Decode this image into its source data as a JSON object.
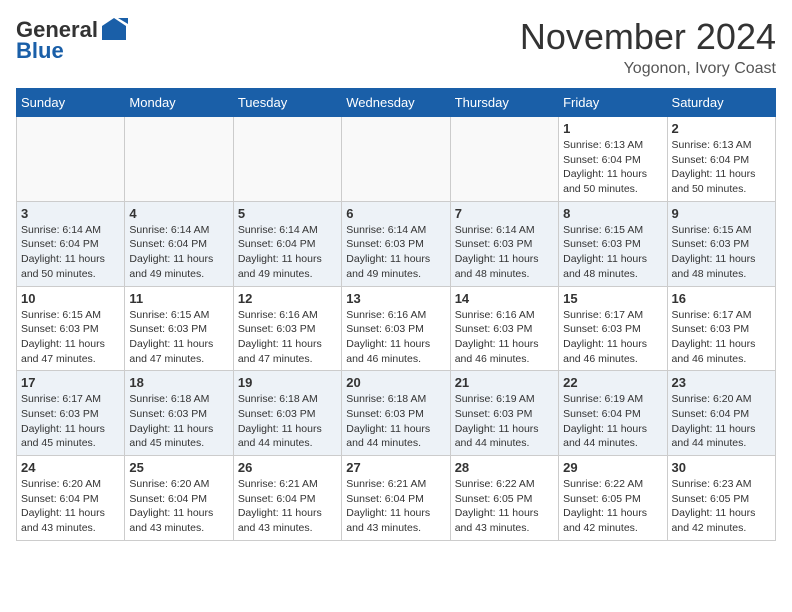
{
  "header": {
    "logo_general": "General",
    "logo_blue": "Blue",
    "month_title": "November 2024",
    "location": "Yogonon, Ivory Coast"
  },
  "weekdays": [
    "Sunday",
    "Monday",
    "Tuesday",
    "Wednesday",
    "Thursday",
    "Friday",
    "Saturday"
  ],
  "weeks": [
    [
      {
        "day": "",
        "info": ""
      },
      {
        "day": "",
        "info": ""
      },
      {
        "day": "",
        "info": ""
      },
      {
        "day": "",
        "info": ""
      },
      {
        "day": "",
        "info": ""
      },
      {
        "day": "1",
        "info": "Sunrise: 6:13 AM\nSunset: 6:04 PM\nDaylight: 11 hours and 50 minutes."
      },
      {
        "day": "2",
        "info": "Sunrise: 6:13 AM\nSunset: 6:04 PM\nDaylight: 11 hours and 50 minutes."
      }
    ],
    [
      {
        "day": "3",
        "info": "Sunrise: 6:14 AM\nSunset: 6:04 PM\nDaylight: 11 hours and 50 minutes."
      },
      {
        "day": "4",
        "info": "Sunrise: 6:14 AM\nSunset: 6:04 PM\nDaylight: 11 hours and 49 minutes."
      },
      {
        "day": "5",
        "info": "Sunrise: 6:14 AM\nSunset: 6:04 PM\nDaylight: 11 hours and 49 minutes."
      },
      {
        "day": "6",
        "info": "Sunrise: 6:14 AM\nSunset: 6:03 PM\nDaylight: 11 hours and 49 minutes."
      },
      {
        "day": "7",
        "info": "Sunrise: 6:14 AM\nSunset: 6:03 PM\nDaylight: 11 hours and 48 minutes."
      },
      {
        "day": "8",
        "info": "Sunrise: 6:15 AM\nSunset: 6:03 PM\nDaylight: 11 hours and 48 minutes."
      },
      {
        "day": "9",
        "info": "Sunrise: 6:15 AM\nSunset: 6:03 PM\nDaylight: 11 hours and 48 minutes."
      }
    ],
    [
      {
        "day": "10",
        "info": "Sunrise: 6:15 AM\nSunset: 6:03 PM\nDaylight: 11 hours and 47 minutes."
      },
      {
        "day": "11",
        "info": "Sunrise: 6:15 AM\nSunset: 6:03 PM\nDaylight: 11 hours and 47 minutes."
      },
      {
        "day": "12",
        "info": "Sunrise: 6:16 AM\nSunset: 6:03 PM\nDaylight: 11 hours and 47 minutes."
      },
      {
        "day": "13",
        "info": "Sunrise: 6:16 AM\nSunset: 6:03 PM\nDaylight: 11 hours and 46 minutes."
      },
      {
        "day": "14",
        "info": "Sunrise: 6:16 AM\nSunset: 6:03 PM\nDaylight: 11 hours and 46 minutes."
      },
      {
        "day": "15",
        "info": "Sunrise: 6:17 AM\nSunset: 6:03 PM\nDaylight: 11 hours and 46 minutes."
      },
      {
        "day": "16",
        "info": "Sunrise: 6:17 AM\nSunset: 6:03 PM\nDaylight: 11 hours and 46 minutes."
      }
    ],
    [
      {
        "day": "17",
        "info": "Sunrise: 6:17 AM\nSunset: 6:03 PM\nDaylight: 11 hours and 45 minutes."
      },
      {
        "day": "18",
        "info": "Sunrise: 6:18 AM\nSunset: 6:03 PM\nDaylight: 11 hours and 45 minutes."
      },
      {
        "day": "19",
        "info": "Sunrise: 6:18 AM\nSunset: 6:03 PM\nDaylight: 11 hours and 44 minutes."
      },
      {
        "day": "20",
        "info": "Sunrise: 6:18 AM\nSunset: 6:03 PM\nDaylight: 11 hours and 44 minutes."
      },
      {
        "day": "21",
        "info": "Sunrise: 6:19 AM\nSunset: 6:03 PM\nDaylight: 11 hours and 44 minutes."
      },
      {
        "day": "22",
        "info": "Sunrise: 6:19 AM\nSunset: 6:04 PM\nDaylight: 11 hours and 44 minutes."
      },
      {
        "day": "23",
        "info": "Sunrise: 6:20 AM\nSunset: 6:04 PM\nDaylight: 11 hours and 44 minutes."
      }
    ],
    [
      {
        "day": "24",
        "info": "Sunrise: 6:20 AM\nSunset: 6:04 PM\nDaylight: 11 hours and 43 minutes."
      },
      {
        "day": "25",
        "info": "Sunrise: 6:20 AM\nSunset: 6:04 PM\nDaylight: 11 hours and 43 minutes."
      },
      {
        "day": "26",
        "info": "Sunrise: 6:21 AM\nSunset: 6:04 PM\nDaylight: 11 hours and 43 minutes."
      },
      {
        "day": "27",
        "info": "Sunrise: 6:21 AM\nSunset: 6:04 PM\nDaylight: 11 hours and 43 minutes."
      },
      {
        "day": "28",
        "info": "Sunrise: 6:22 AM\nSunset: 6:05 PM\nDaylight: 11 hours and 43 minutes."
      },
      {
        "day": "29",
        "info": "Sunrise: 6:22 AM\nSunset: 6:05 PM\nDaylight: 11 hours and 42 minutes."
      },
      {
        "day": "30",
        "info": "Sunrise: 6:23 AM\nSunset: 6:05 PM\nDaylight: 11 hours and 42 minutes."
      }
    ]
  ]
}
